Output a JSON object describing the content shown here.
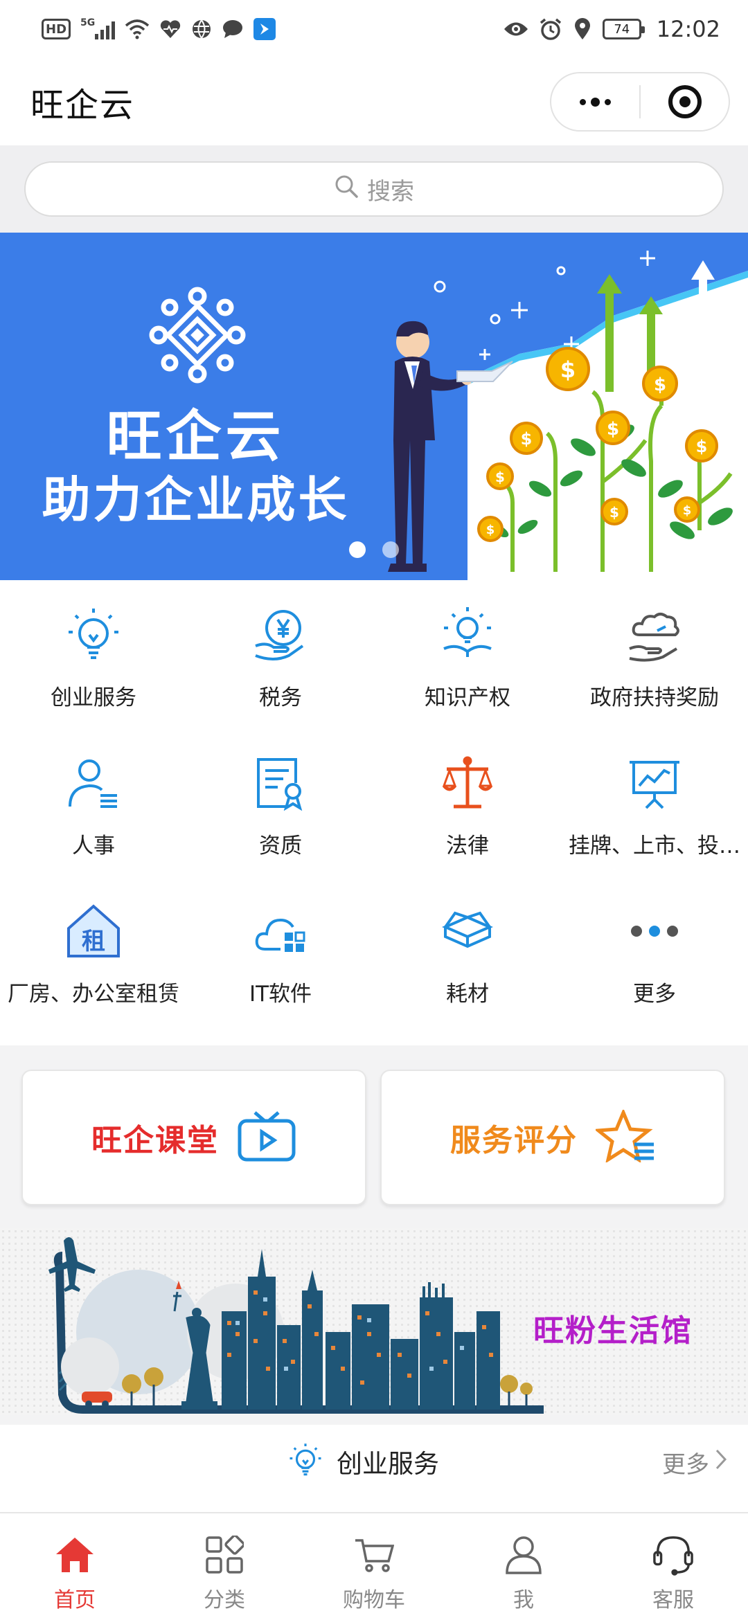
{
  "status_bar": {
    "left_icons": [
      "hd-icon",
      "5g-signal-icon",
      "wifi-icon",
      "health-icon",
      "browser-icon",
      "chat-icon",
      "app-notification-icon"
    ],
    "hd_label": "HD",
    "net_label": "5G",
    "right_icons": [
      "eye-icon",
      "alarm-icon",
      "location-icon"
    ],
    "battery_level": "74",
    "time": "12:02"
  },
  "title_bar": {
    "title": "旺企云",
    "menu_icon": "more-dots-icon",
    "close_icon": "target-close-icon"
  },
  "search": {
    "placeholder": "搜索"
  },
  "banner": {
    "line1": "旺企云",
    "line2": "助力企业成长",
    "page_count": 2,
    "active_page": 0
  },
  "categories": [
    {
      "label": "创业服务",
      "icon": "lightbulb-icon"
    },
    {
      "label": "税务",
      "icon": "yuan-hand-icon"
    },
    {
      "label": "知识产权",
      "icon": "idea-book-icon"
    },
    {
      "label": "政府扶持奖励",
      "icon": "cloud-hand-icon"
    },
    {
      "label": "人事",
      "icon": "person-list-icon"
    },
    {
      "label": "资质",
      "icon": "certificate-icon"
    },
    {
      "label": "法律",
      "icon": "scales-icon"
    },
    {
      "label": "挂牌、上市、投…",
      "icon": "presentation-chart-icon"
    },
    {
      "label": "厂房、办公室租赁",
      "icon": "rent-house-icon"
    },
    {
      "label": "IT软件",
      "icon": "cloud-apps-icon"
    },
    {
      "label": "耗材",
      "icon": "box-icon"
    },
    {
      "label": "更多",
      "icon": "more-dots-icon"
    }
  ],
  "feature_cards": [
    {
      "label": "旺企课堂",
      "icon": "tv-play-icon"
    },
    {
      "label": "服务评分",
      "icon": "star-list-icon"
    }
  ],
  "promo": {
    "label": "旺粉生活馆"
  },
  "section": {
    "title": "创业服务",
    "more": "更多"
  },
  "tabs": [
    {
      "label": "首页",
      "icon": "home-icon",
      "active": true
    },
    {
      "label": "分类",
      "icon": "category-grid-icon",
      "active": false
    },
    {
      "label": "购物车",
      "icon": "cart-icon",
      "active": false
    },
    {
      "label": "我",
      "icon": "user-icon",
      "active": false
    },
    {
      "label": "客服",
      "icon": "headset-icon",
      "active": false
    }
  ],
  "colors": {
    "brand_blue": "#3b7de8",
    "icon_blue": "#1e8ede",
    "accent_red": "#e53935",
    "accent_orange": "#f08a1c",
    "promo_purple": "#b41fc9"
  }
}
